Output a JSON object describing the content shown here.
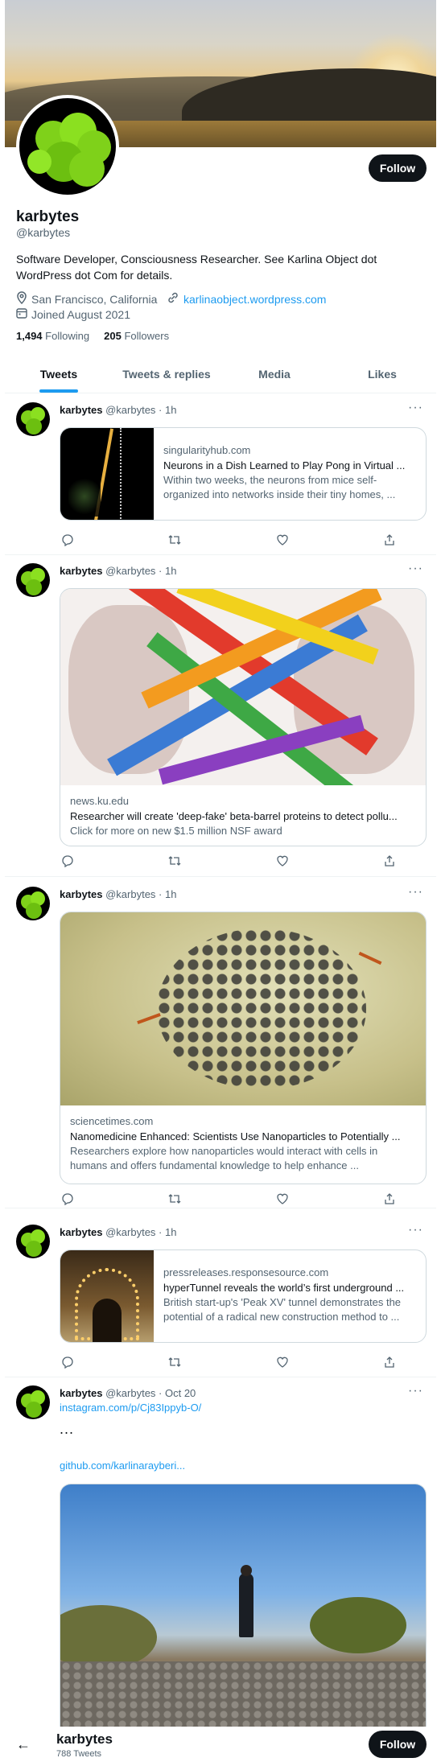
{
  "profile": {
    "name": "karbytes",
    "handle": "@karbytes",
    "bio": "Software Developer, Consciousness Researcher. See Karlina Object dot WordPress dot Com for details.",
    "location": "San Francisco, California",
    "website": "karlinaobject.wordpress.com",
    "joined": "Joined August 2021",
    "following_count": "1,494",
    "following_label": "Following",
    "followers_count": "205",
    "followers_label": "Followers",
    "follow_label": "Follow"
  },
  "tabs": [
    {
      "label": "Tweets",
      "active": true
    },
    {
      "label": "Tweets & replies",
      "active": false
    },
    {
      "label": "Media",
      "active": false
    },
    {
      "label": "Likes",
      "active": false
    }
  ],
  "tweets": [
    {
      "name": "karbytes",
      "meta": "@karbytes · 1h",
      "card": {
        "domain": "singularityhub.com",
        "title": "Neurons in a Dish Learned to Play Pong in Virtual ...",
        "desc": "Within two weeks, the neurons from mice self-organized into networks inside their tiny homes, ..."
      }
    },
    {
      "name": "karbytes",
      "meta": "@karbytes · 1h",
      "card": {
        "domain": "news.ku.edu",
        "title": "Researcher will create 'deep-fake' beta-barrel proteins to detect pollu...",
        "desc": "Click for more on new $1.5 million NSF award"
      }
    },
    {
      "name": "karbytes",
      "meta": "@karbytes · 1h",
      "card": {
        "domain": "sciencetimes.com",
        "title": "Nanomedicine Enhanced: Scientists Use Nanoparticles to Potentially ...",
        "desc": "Researchers explore how nanoparticles would interact with cells in humans and offers fundamental knowledge to help enhance ..."
      }
    },
    {
      "name": "karbytes",
      "meta": "@karbytes · 1h",
      "card": {
        "domain": "pressreleases.responsesource.com",
        "title": "hyperTunnel reveals the world’s first underground ...",
        "desc": "British start-up's 'Peak XV' tunnel demonstrates the potential of a radical new construction method to ..."
      }
    },
    {
      "name": "karbytes",
      "meta": "@karbytes · Oct 20",
      "link1": "instagram.com/p/Cj83Ippyb-O/",
      "ellipsis": "...",
      "link2": "github.com/karlinarayberi..."
    }
  ],
  "bottom_bar": {
    "back": "←",
    "name": "karbytes",
    "sub": "788 Tweets",
    "follow_label": "Follow"
  },
  "colors": {
    "accent": "#1d9bf0",
    "text": "#0f1419",
    "muted": "#536471",
    "border": "#cfd9de"
  }
}
